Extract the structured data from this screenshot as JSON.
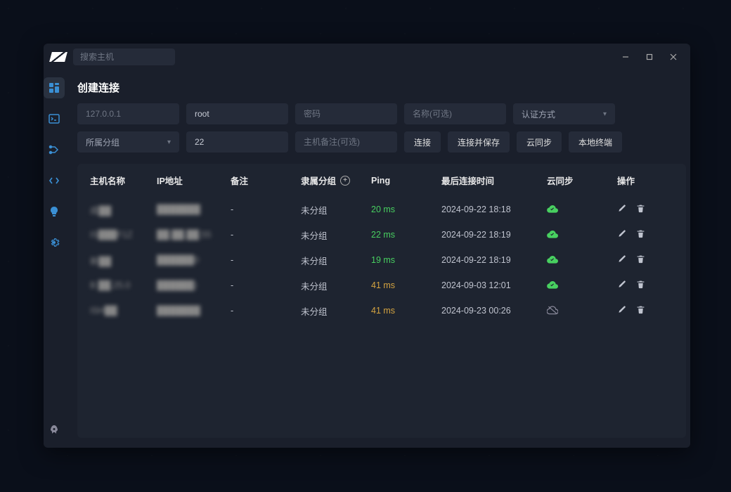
{
  "titlebar": {
    "search_placeholder": "搜索主机"
  },
  "page": {
    "title": "创建连接"
  },
  "form": {
    "ip_placeholder": "127.0.0.1",
    "user_value": "root",
    "pass_placeholder": "密码",
    "name_placeholder": "名称(可选)",
    "auth_label": "认证方式",
    "group_label": "所属分组",
    "port_value": "22",
    "note_placeholder": "主机备注(可选)",
    "btn_connect": "连接",
    "btn_connect_save": "连接并保存",
    "btn_cloud_sync": "云同步",
    "btn_local_terminal": "本地终端"
  },
  "table": {
    "headers": {
      "host": "主机名称",
      "ip": "IP地址",
      "note": "备注",
      "group": "隶属分组",
      "ping": "Ping",
      "last": "最后连接时间",
      "sync": "云同步",
      "actions": "操作"
    },
    "rows": [
      {
        "host": "成██",
        "ip": "███████",
        "note": "-",
        "group": "未分组",
        "ping": "20 ms",
        "ping_status": "good",
        "last": "2024-09-22 18:18",
        "sync": true
      },
      {
        "host": "IS███F1Z",
        "ip": "██.██.██.55",
        "note": "-",
        "group": "未分组",
        "ping": "22 ms",
        "ping_status": "good",
        "last": "2024-09-22 18:19",
        "sync": true
      },
      {
        "host": "新██",
        "ip": "██████0",
        "note": "-",
        "group": "未分组",
        "ping": "19 ms",
        "ping_status": "good",
        "last": "2024-09-22 18:19",
        "sync": true
      },
      {
        "host": "B ██.25.0",
        "ip": "██████)",
        "note": "-",
        "group": "未分组",
        "ping": "41 ms",
        "ping_status": "warn",
        "last": "2024-09-03 12:01",
        "sync": true
      },
      {
        "host": "ISH██",
        "ip": "███████",
        "note": "-",
        "group": "未分组",
        "ping": "41 ms",
        "ping_status": "warn",
        "last": "2024-09-23 00:26",
        "sync": false
      }
    ]
  },
  "icons": {
    "sidebar": [
      "dashboard",
      "terminal",
      "node",
      "code",
      "bulb",
      "gear"
    ],
    "sidebar_bottom": "rocket"
  }
}
